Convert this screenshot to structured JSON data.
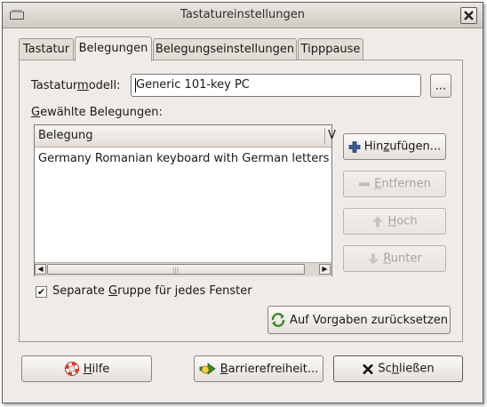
{
  "window": {
    "title": "Tastatureinstellungen"
  },
  "tabs": [
    {
      "label": "Tastatur"
    },
    {
      "label": "Belegungen"
    },
    {
      "label": "Belegungseinstellungen"
    },
    {
      "label": "Tipppause"
    }
  ],
  "active_tab": "Belegungen",
  "model": {
    "label_pre": "Tastatur",
    "label_u": "m",
    "label_post": "odell:",
    "value": "Generic 101-key PC",
    "browse_label": "..."
  },
  "layouts": {
    "label_u": "G",
    "label_post": "ewählte Belegungen:",
    "column_header": "Belegung",
    "column_header_2": "V",
    "rows": [
      "Germany Romanian keyboard with German letters"
    ]
  },
  "side_buttons": {
    "add": {
      "pre": "Hin",
      "u": "z",
      "post": "ufügen..."
    },
    "remove": {
      "pre": "",
      "u": "E",
      "post": "ntfernen"
    },
    "up": {
      "pre": "",
      "u": "H",
      "post": "och"
    },
    "down": {
      "pre": "",
      "u": "R",
      "post": "unter"
    }
  },
  "separate_group": {
    "checked": true,
    "check_glyph": "✔",
    "pre": "Separate ",
    "u": "G",
    "post": "ruppe für jedes Fenster"
  },
  "reset": {
    "pre": "Auf Vor",
    "u": "g",
    "post": "aben zurücksetzen"
  },
  "footer": {
    "help": {
      "pre": "",
      "u": "H",
      "post": "ilfe"
    },
    "accessibility": {
      "pre": "",
      "u": "B",
      "post": "arrierefreiheit..."
    },
    "close": {
      "pre": "Sc",
      "u": "h",
      "post": "ließen"
    }
  },
  "scroll_grip": "|||",
  "colors": {
    "window_bg": "#efebe7",
    "border": "#8a857d",
    "add_icon": "#3b5a9a",
    "disabled_text": "#a9a49d"
  },
  "icons": [
    "window-menu-icon",
    "close-icon",
    "add-icon",
    "remove-icon",
    "arrow-up-icon",
    "arrow-down-icon",
    "lifebuoy-icon",
    "accessibility-icon",
    "close-x-icon",
    "reset-icon"
  ]
}
